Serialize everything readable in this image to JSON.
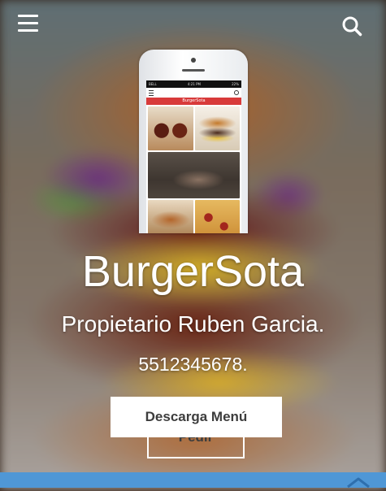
{
  "header": {
    "menu_icon": "hamburger-menu-icon",
    "search_icon": "search-icon"
  },
  "phone_mockup": {
    "app_name": "BurgerSota",
    "status_carrier": "BELL",
    "status_time": "4:21 PM",
    "status_battery": "22%"
  },
  "hero": {
    "title": "BurgerSota",
    "owner": "Propietario Ruben Garcia.",
    "phone": "5512345678."
  },
  "actions": {
    "download_label": "Descarga Menú",
    "order_label": "Pedir"
  },
  "colors": {
    "bottom_bar": "#4f97d6",
    "app_brand_bar": "#d83a3a"
  }
}
